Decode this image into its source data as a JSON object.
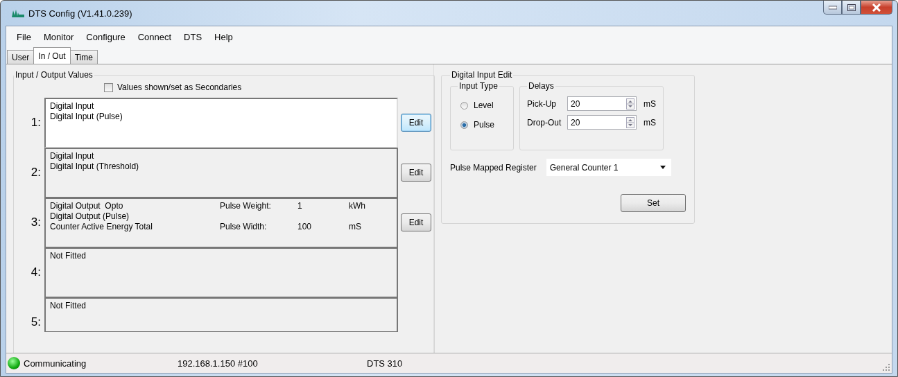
{
  "window": {
    "title": "DTS Config (V1.41.0.239)"
  },
  "menu": [
    "File",
    "Monitor",
    "Configure",
    "Connect",
    "DTS",
    "Help"
  ],
  "tabs": [
    {
      "label": "User",
      "selected": false
    },
    {
      "label": "In / Out",
      "selected": true
    },
    {
      "label": "Time",
      "selected": false
    }
  ],
  "io_group": {
    "title": "Input / Output Values",
    "secondaries": {
      "label": "Values shown/set as Secondaries",
      "checked": false
    },
    "channels": [
      {
        "number": "1:",
        "lines": [
          "Digital Input",
          "Digital Input (Pulse)"
        ],
        "selected": true,
        "edit_button": "Edit"
      },
      {
        "number": "2:",
        "lines": [
          "Digital Input",
          "Digital Input (Threshold)"
        ],
        "selected": false,
        "edit_button": "Edit"
      },
      {
        "number": "3:",
        "lines": [
          "Digital Output  Opto",
          "Digital Output (Pulse)",
          "Counter Active Energy Total"
        ],
        "selected": false,
        "edit_button": "Edit",
        "params": [
          {
            "label": "Pulse Weight:",
            "value": "1",
            "unit": "kWh"
          },
          {
            "label": "Pulse Width:",
            "value": "100",
            "unit": "mS"
          }
        ]
      },
      {
        "number": "4:",
        "lines": [
          "Not Fitted"
        ],
        "selected": false
      },
      {
        "number": "5:",
        "lines": [
          "Not Fitted"
        ],
        "selected": false
      }
    ]
  },
  "edit_group": {
    "title": "Digital Input Edit",
    "input_type": {
      "title": "Input Type",
      "options": [
        {
          "label": "Level",
          "selected": false
        },
        {
          "label": "Pulse",
          "selected": true
        }
      ]
    },
    "delays": {
      "title": "Delays",
      "fields": [
        {
          "label": "Pick-Up",
          "value": "20",
          "unit": "mS"
        },
        {
          "label": "Drop-Out",
          "value": "20",
          "unit": "mS"
        }
      ]
    },
    "register": {
      "label": "Pulse Mapped Register",
      "value": "General Counter 1"
    },
    "set_button": "Set"
  },
  "status_bar": {
    "connected": true,
    "status": "Communicating",
    "address": "192.168.1.150 #100",
    "device": "DTS 310"
  }
}
